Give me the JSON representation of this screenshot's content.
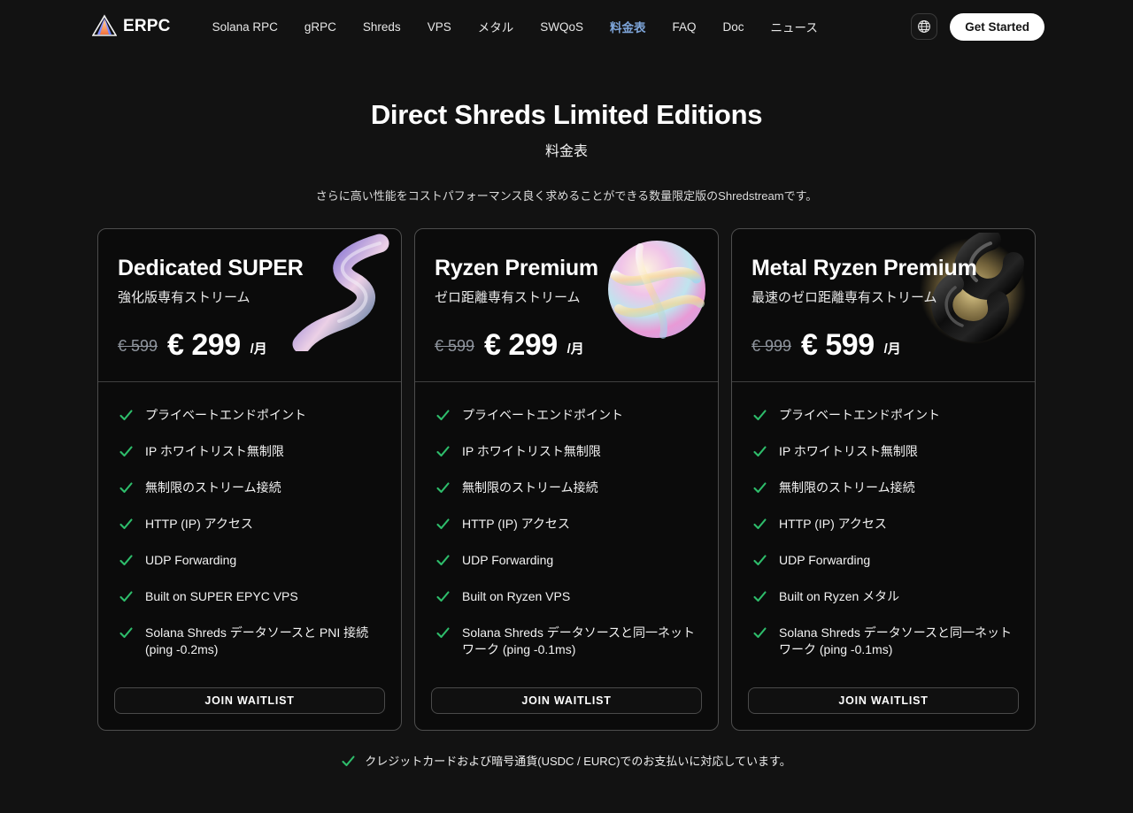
{
  "header": {
    "logo_text": "ERPC",
    "nav": [
      {
        "label": "Solana RPC",
        "active": false
      },
      {
        "label": "gRPC",
        "active": false
      },
      {
        "label": "Shreds",
        "active": false
      },
      {
        "label": "VPS",
        "active": false
      },
      {
        "label": "メタル",
        "active": false
      },
      {
        "label": "SWQoS",
        "active": false
      },
      {
        "label": "料金表",
        "active": true
      },
      {
        "label": "FAQ",
        "active": false
      },
      {
        "label": "Doc",
        "active": false
      },
      {
        "label": "ニュース",
        "active": false
      }
    ],
    "language_icon": "globe-icon",
    "cta_label": "Get Started"
  },
  "hero": {
    "title": "Direct Shreds Limited Editions",
    "subtitle": "料金表",
    "description": "さらに高い性能をコストパフォーマンス良く求めることができる数量限定版のShredstreamです。"
  },
  "cards": [
    {
      "name": "Dedicated SUPER",
      "tagline": "強化版専有ストリーム",
      "old_price": "€ 599",
      "price": "€ 299",
      "period": "/月",
      "art": "iridescent-swirl",
      "features": [
        "プライベートエンドポイント",
        "IP ホワイトリスト無制限",
        "無制限のストリーム接続",
        "HTTP (IP) アクセス",
        "UDP Forwarding",
        "Built on SUPER EPYC VPS",
        "Solana Shreds データソースと PNI 接続 (ping -0.2ms)"
      ],
      "cta_label": "JOIN WAITLIST"
    },
    {
      "name": "Ryzen Premium",
      "tagline": "ゼロ距離専有ストリーム",
      "old_price": "€ 599",
      "price": "€ 299",
      "period": "/月",
      "art": "iridescent-sphere",
      "features": [
        "プライベートエンドポイント",
        "IP ホワイトリスト無制限",
        "無制限のストリーム接続",
        "HTTP (IP) アクセス",
        "UDP Forwarding",
        "Built on Ryzen VPS",
        "Solana Shreds データソースと同一ネットワーク (ping -0.1ms)"
      ],
      "cta_label": "JOIN WAITLIST"
    },
    {
      "name": "Metal Ryzen Premium",
      "tagline": "最速のゼロ距離専有ストリーム",
      "old_price": "€ 999",
      "price": "€ 599",
      "period": "/月",
      "art": "black-metal-rings",
      "features": [
        "プライベートエンドポイント",
        "IP ホワイトリスト無制限",
        "無制限のストリーム接続",
        "HTTP (IP) アクセス",
        "UDP Forwarding",
        "Built on Ryzen メタル",
        "Solana Shreds データソースと同一ネットワーク (ping -0.1ms)"
      ],
      "cta_label": "JOIN WAITLIST"
    }
  ],
  "footer": {
    "note": "クレジットカードおよび暗号通貨(USDC / EURC)でのお支払いに対応しています。"
  },
  "colors": {
    "accent_blue": "#7da4d8",
    "check_green": "#2ebd6b",
    "page_bg": "#121212",
    "card_bg": "#0b0b0b"
  }
}
